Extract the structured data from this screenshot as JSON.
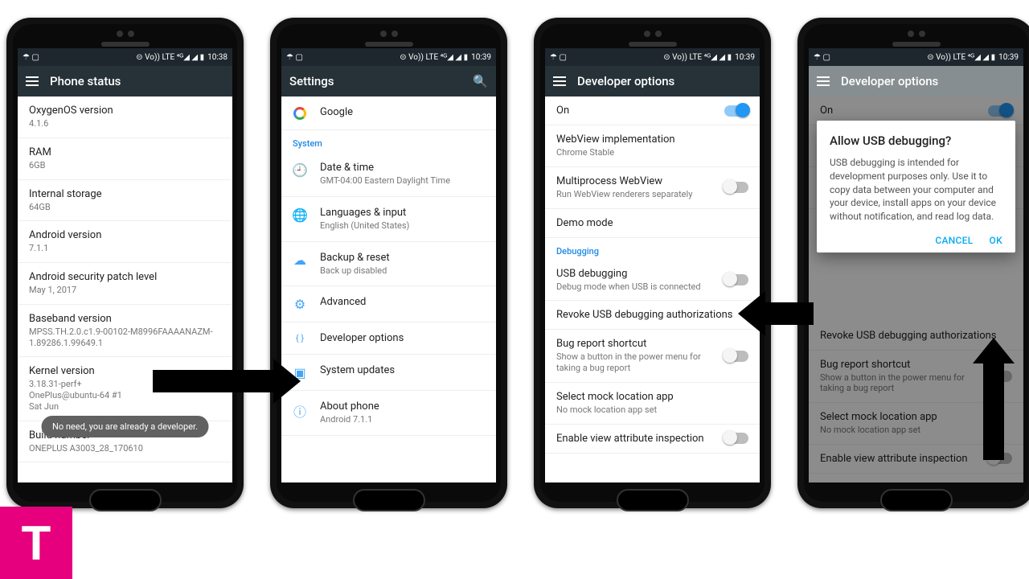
{
  "statusbar": {
    "left_icons": "☂ ▢",
    "right_icons_a": "⊝ Vo)) LTE ⁴ᴳ◢ ◢ ▮",
    "time1": "10:38",
    "time2": "10:39"
  },
  "logo_letter": "T",
  "phone1": {
    "title": "Phone status",
    "toast": "No need, you are already a developer.",
    "items": [
      {
        "t1": "OxygenOS version",
        "t2": "4.1.6"
      },
      {
        "t1": "RAM",
        "t2": "6GB"
      },
      {
        "t1": "Internal storage",
        "t2": "64GB"
      },
      {
        "t1": "Android version",
        "t2": "7.1.1"
      },
      {
        "t1": "Android security patch level",
        "t2": "May 1, 2017"
      },
      {
        "t1": "Baseband version",
        "t2": "MPSS.TH.2.0.c1.9-00102-M8996FAAAANAZM-1.89286.1.99649.1"
      },
      {
        "t1": "Kernel version",
        "t2": "3.18.31-perf+\nOnePlus@ubuntu-64 #1\nSat Jun"
      },
      {
        "t1": "Build number",
        "t2": "ONEPLUS A3003_28_170610"
      }
    ]
  },
  "phone2": {
    "title": "Settings",
    "google": "Google",
    "section": "System",
    "items": [
      {
        "icon": "🕘",
        "t1": "Date & time",
        "t2": "GMT-04:00 Eastern Daylight Time"
      },
      {
        "icon": "🌐",
        "t1": "Languages & input",
        "t2": "English (United States)"
      },
      {
        "icon": "☁",
        "t1": "Backup & reset",
        "t2": "Back up disabled"
      },
      {
        "icon": "⚙",
        "t1": "Advanced",
        "t2": ""
      },
      {
        "icon": "{ }",
        "t1": "Developer options",
        "t2": ""
      },
      {
        "icon": "▣",
        "t1": "System updates",
        "t2": ""
      },
      {
        "icon": "ⓘ",
        "t1": "About phone",
        "t2": "Android 7.1.1"
      }
    ]
  },
  "phone3": {
    "title": "Developer options",
    "on_label": "On",
    "section": "Debugging",
    "items_top": [
      {
        "t1": "WebView implementation",
        "t2": "Chrome Stable"
      },
      {
        "t1": "Multiprocess WebView",
        "t2": "Run WebView renderers separately",
        "toggle": "off"
      },
      {
        "t1": "Demo mode",
        "t2": ""
      }
    ],
    "items_dbg": [
      {
        "t1": "USB debugging",
        "t2": "Debug mode when USB is connected",
        "toggle": "off"
      },
      {
        "t1": "Revoke USB debugging authorizations",
        "t2": ""
      },
      {
        "t1": "Bug report shortcut",
        "t2": "Show a button in the power menu for taking a bug report",
        "toggle": "off"
      },
      {
        "t1": "Select mock location app",
        "t2": "No mock location app set"
      },
      {
        "t1": "Enable view attribute inspection",
        "t2": "",
        "toggle": "off"
      }
    ]
  },
  "phone4": {
    "title": "Developer options",
    "dialog": {
      "title": "Allow USB debugging?",
      "text": "USB debugging is intended for development purposes only. Use it to copy data between your computer and your device, install apps on your device without notification, and read log data.",
      "cancel": "CANCEL",
      "ok": "OK"
    }
  }
}
